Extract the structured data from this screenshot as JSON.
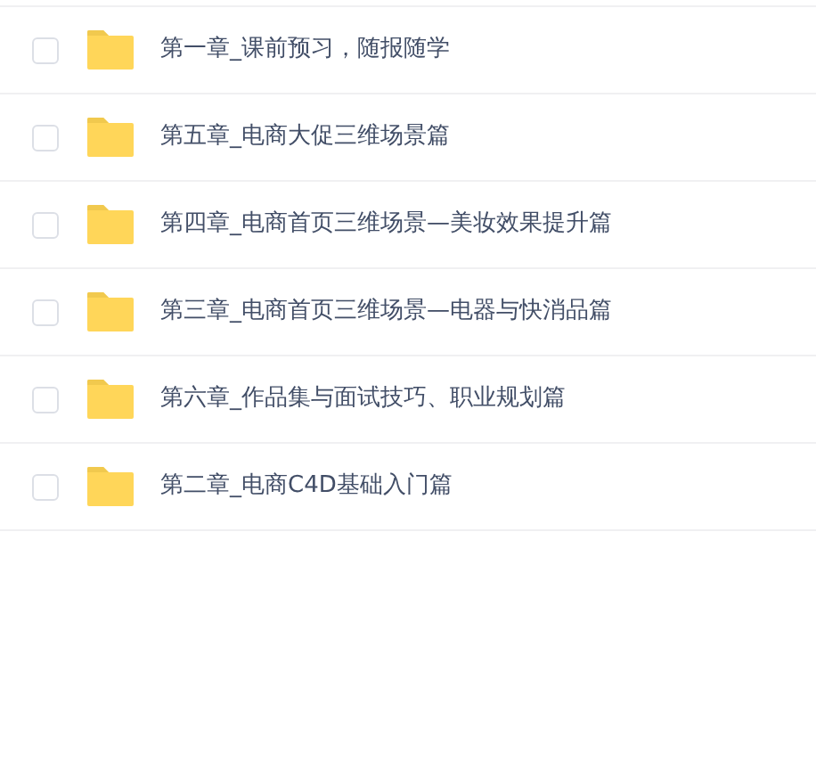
{
  "files": [
    {
      "name": "第一章_课前预习，随报随学",
      "checked": false
    },
    {
      "name": "第五章_电商大促三维场景篇",
      "checked": false
    },
    {
      "name": "第四章_电商首页三维场景—美妆效果提升篇",
      "checked": false
    },
    {
      "name": "第三章_电商首页三维场景—电器与快消品篇",
      "checked": false
    },
    {
      "name": "第六章_作品集与面试技巧、职业规划篇",
      "checked": false
    },
    {
      "name": "第二章_电商C4D基础入门篇",
      "checked": false
    }
  ]
}
